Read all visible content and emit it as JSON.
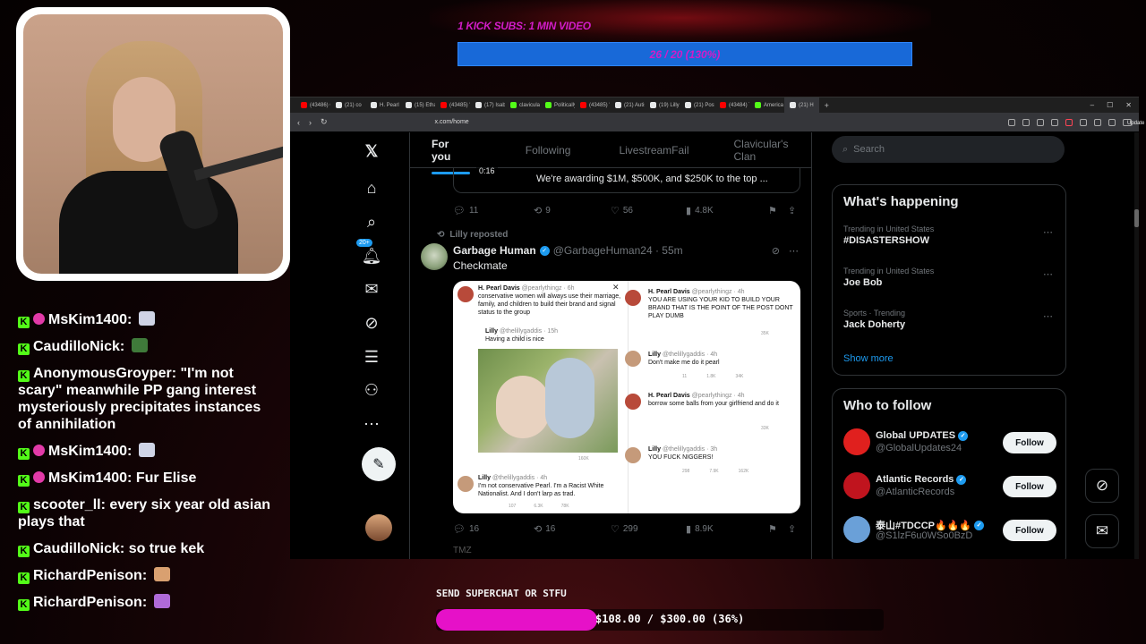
{
  "overlay": {
    "subs_goal_label": "1 KICK SUBS: 1 MIN VIDEO",
    "subs_progress_text": "26 / 20 (130%)",
    "subs_progress_fraction": 1.3,
    "superchat_label": "SEND SUPERCHAT OR STFU",
    "superchat_progress_text": "$108.00 / $300.00 (36%)",
    "superchat_progress_fraction": 0.36,
    "accent_pink": "#e611c8",
    "subs_bar_color": "#1869d8"
  },
  "chat": [
    {
      "user": "MsKim1400",
      "text": "",
      "badge": true,
      "emote": "#cfd4e6"
    },
    {
      "user": "CaudilloNick",
      "text": "",
      "badge": false,
      "emote": "#3f7a3a"
    },
    {
      "user": "AnonymousGroyper",
      "text": "\"I'm not scary\" meanwhile PP gang interest mysteriously precipitates instances of annihilation",
      "badge": false,
      "emote": ""
    },
    {
      "user": "MsKim1400",
      "text": "",
      "badge": true,
      "emote": "#cfd4e6"
    },
    {
      "user": "MsKim1400",
      "text": "Fur Elise",
      "badge": true,
      "emote": ""
    },
    {
      "user": "scooter_ll",
      "text": "every six year old asian plays that",
      "badge": false,
      "emote": ""
    },
    {
      "user": "CaudilloNick",
      "text": "so true kek",
      "badge": false,
      "emote": ""
    },
    {
      "user": "RichardPenison",
      "text": "",
      "badge": false,
      "emote": "#d9a070"
    },
    {
      "user": "RichardPenison",
      "text": "",
      "badge": false,
      "emote": "#b06ad8"
    }
  ],
  "browser": {
    "tabs": [
      {
        "label": "(43486) Cli",
        "color": "#ff0000"
      },
      {
        "label": "(21) co",
        "color": "#e7e9ea"
      },
      {
        "label": "H. Pearl",
        "color": "#e7e9ea"
      },
      {
        "label": "(15) Ethan",
        "color": "#e7e9ea"
      },
      {
        "label": "(43485) \"E",
        "color": "#ff0000"
      },
      {
        "label": "(17) Isabel",
        "color": "#e7e9ea"
      },
      {
        "label": "clavicular S",
        "color": "#53fc18"
      },
      {
        "label": "PoliticallyP",
        "color": "#53fc18"
      },
      {
        "label": "(43485) 'M",
        "color": "#ff0000"
      },
      {
        "label": "(21) Autism",
        "color": "#e7e9ea"
      },
      {
        "label": "(19) Lilly",
        "color": "#e7e9ea"
      },
      {
        "label": "(21) Posts",
        "color": "#e7e9ea"
      },
      {
        "label": "(43484) Th",
        "color": "#ff0000"
      },
      {
        "label": "America Fi",
        "color": "#53fc18"
      },
      {
        "label": "(21) H",
        "color": "#e7e9ea",
        "active": true
      }
    ],
    "url": "x.com/home",
    "update_label": "Update"
  },
  "x": {
    "tabs": [
      "For you",
      "Following",
      "LivestreamFail",
      "Clavicular's Clan"
    ],
    "notif_badge": "20+",
    "video_post": {
      "time": "0:16",
      "title": "We're awarding $1M, $500K, and $250K to the top ...",
      "replies": "11",
      "reposts": "9",
      "likes": "56",
      "views": "4.8K"
    },
    "post": {
      "repost_label": "Lilly reposted",
      "name": "Garbage Human",
      "handle": "@GarbageHuman24 · 55m",
      "text": "Checkmate",
      "replies": "16",
      "reposts": "16",
      "likes": "299",
      "views": "8.9K"
    },
    "embedded": {
      "left1_name": "H. Pearl Davis",
      "left1_handle": "@pearlythingz · 6h",
      "left1_text": "conservative women will always use their marriage, family, and children to build their brand and signal status to the group",
      "left2_name": "Lilly",
      "left2_handle": "@thelillygaddis · 15h",
      "left2_text": "Having a child is nice",
      "left2_views": "160K",
      "left3_name": "Lilly",
      "left3_handle": "@thelillygaddis · 4h",
      "left3_text": "I'm not conservative Pearl. I'm a Racist White Nationalist. And I don't larp as trad.",
      "left3_stats": [
        "107",
        "6.3K",
        "78K"
      ],
      "right1_name": "H. Pearl Davis",
      "right1_handle": "@pearlythingz · 4h",
      "right1_text": "YOU ARE USING YOUR KID TO BUILD YOUR BRAND THAT IS THE POINT OF THE POST DONT PLAY DUMB",
      "right1_views": "35K",
      "right2_name": "Lilly",
      "right2_handle": "@thelillygaddis · 4h",
      "right2_text": "Don't make me do it pearl",
      "right2_stats": [
        "11",
        "1.8K",
        "34K"
      ],
      "right3_name": "H. Pearl Davis",
      "right3_handle": "@pearlythingz · 4h",
      "right3_text": "borrow some balls from your girlfriend and do it",
      "right3_views": "33K",
      "right4_name": "Lilly",
      "right4_handle": "@thelillygaddis · 3h",
      "right4_text": "YOU FUCK NIGGERS!",
      "right4_stats": [
        "298",
        "7.9K",
        "162K"
      ]
    },
    "next_post_name": "TMZ",
    "search_placeholder": "Search",
    "whats_happening": "What's happening",
    "trends": [
      {
        "meta": "Trending in United States",
        "topic": "#DISASTERSHOW"
      },
      {
        "meta": "Trending in United States",
        "topic": "Joe Bob"
      },
      {
        "meta": "Sports · Trending",
        "topic": "Jack Doherty"
      }
    ],
    "show_more": "Show more",
    "who_to_follow": "Who to follow",
    "follow_suggestions": [
      {
        "name": "Global UPDATES",
        "handle": "@GlobalUpdates24",
        "color": "#e0201e"
      },
      {
        "name": "Atlantic Records",
        "handle": "@AtlanticRecords",
        "color": "#c0141e"
      },
      {
        "name": "泰山#TDCCP🔥🔥🔥",
        "handle": "@S1lzF6u0WSo0BzD",
        "color": "#6aa0d8"
      }
    ],
    "follow_label": "Follow"
  }
}
